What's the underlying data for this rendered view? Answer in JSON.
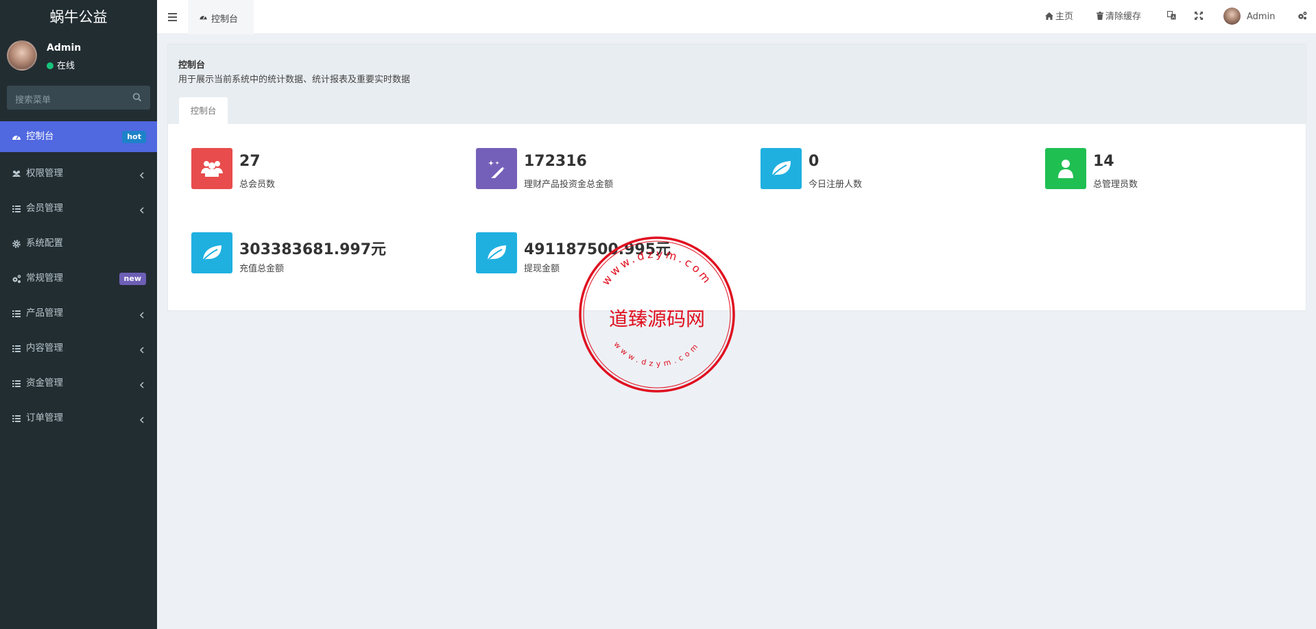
{
  "app": {
    "title": "蜗牛公益"
  },
  "user": {
    "name": "Admin",
    "status": "在线"
  },
  "search": {
    "placeholder": "搜索菜单"
  },
  "menu": [
    {
      "label": "控制台",
      "icon": "dashboard-icon",
      "badge": "hot",
      "active": true
    },
    {
      "label": "权限管理",
      "icon": "users-icon",
      "has_children": true
    },
    {
      "label": "会员管理",
      "icon": "list-icon",
      "has_children": true
    },
    {
      "label": "系统配置",
      "icon": "cog-icon"
    },
    {
      "label": "常规管理",
      "icon": "cogs-icon",
      "badge": "new"
    },
    {
      "label": "产品管理",
      "icon": "list-icon",
      "has_children": true
    },
    {
      "label": "内容管理",
      "icon": "list-icon",
      "has_children": true
    },
    {
      "label": "资金管理",
      "icon": "list-icon",
      "has_children": true
    },
    {
      "label": "订单管理",
      "icon": "list-icon",
      "has_children": true
    }
  ],
  "topbar": {
    "tab_label": "控制台",
    "home": "主页",
    "clear_cache": "清除缓存",
    "user_name": "Admin"
  },
  "page": {
    "title": "控制台",
    "description": "用于展示当前系统中的统计数据、统计报表及重要实时数据",
    "tab": "控制台"
  },
  "stats": [
    {
      "value": "27",
      "label": "总会员数",
      "color": "#e84c4c",
      "icon": "users-icon"
    },
    {
      "value": "172316",
      "label": "理财产品投资金总金额",
      "color": "#7460b8",
      "icon": "magic-wand-icon"
    },
    {
      "value": "0",
      "label": "今日注册人数",
      "color": "#1fb0e0",
      "icon": "leaf-icon"
    },
    {
      "value": "14",
      "label": "总管理员数",
      "color": "#20bf52",
      "icon": "user-icon"
    },
    {
      "value": "303383681.997元",
      "label": "充值总金额",
      "color": "#1fb0e0",
      "icon": "leaf-icon"
    },
    {
      "value": "491187500.995元",
      "label": "提现金额",
      "color": "#1fb0e0",
      "icon": "leaf-icon"
    }
  ],
  "watermark": {
    "text": "道臻源码网",
    "ring": "www.dzym.com"
  },
  "colors": {
    "sidebar": "#222d32",
    "active": "#5068e0",
    "stamp": "#e01020"
  }
}
